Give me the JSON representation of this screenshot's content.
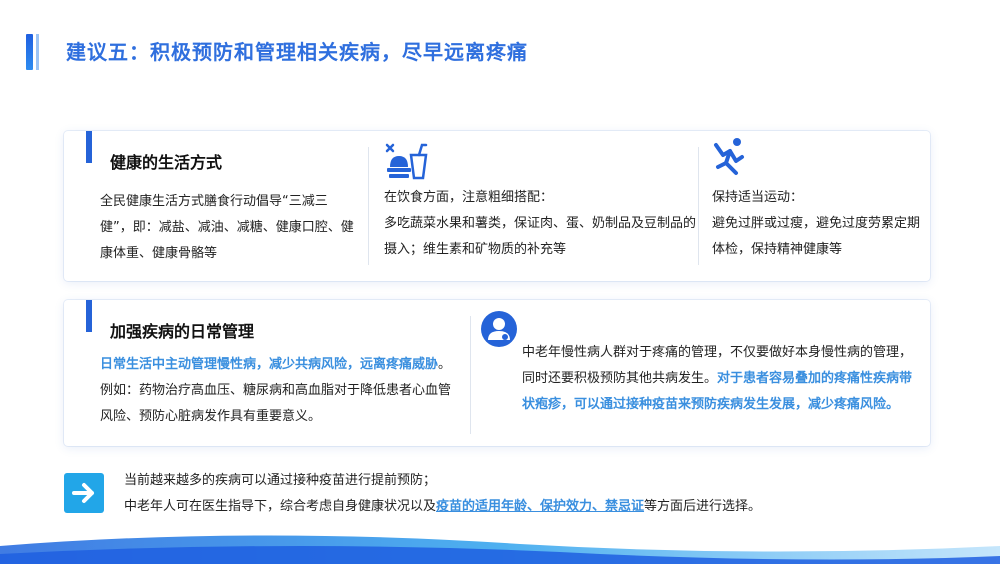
{
  "page": {
    "title": "建议五：积极预防和管理相关疾病，尽早远离疼痛"
  },
  "section1": {
    "title": "健康的生活方式",
    "col1_text": "全民健康生活方式膳食行动倡导“三减三健”，即：减盐、减油、减糖、健康口腔、健康体重、健康骨骼等",
    "col2_line1": "在饮食方面，注意粗细搭配：",
    "col2_line2": "多吃蔬菜水果和薯类，保证肉、蛋、奶制品及豆制品的摄入；维生素和矿物质的补充等",
    "col3_line1": "保持适当运动：",
    "col3_line2": "避免过胖或过瘦，避免过度劳累定期体检，保持精神健康等"
  },
  "section2": {
    "title": "加强疾病的日常管理",
    "left_highlight": "日常生活中主动管理慢性病，减少共病风险，远离疼痛威胁",
    "left_text": "。例如：药物治疗高血压、糖尿病和高血脂对于降低患者心血管风险、预防心脏病发作具有重要意义。",
    "right_text": "中老年慢性病人群对于疼痛的管理，不仅要做好本身慢性病的管理，同时还要积极预防其他共病发生。",
    "right_highlight": "对于患者容易叠加的疼痛性疾病带状疱疹，可以通过接种疫苗来预防疾病发生发展，减少疼痛风险。"
  },
  "footer": {
    "line1": "当前越来越多的疾病可以通过接种疫苗进行提前预防；",
    "line2_prefix": "中老年人可在医生指导下，综合考虑自身健康状况以及",
    "line2_highlight": "疫苗的适用年龄、保护效力、禁忌证",
    "line2_suffix": "等方面后进行选择。"
  },
  "icons": {
    "food": "food-drink-icon",
    "exercise": "running-person-icon",
    "doctor": "doctor-avatar-icon",
    "arrow": "arrow-right-icon"
  },
  "colors": {
    "accent": "#2f6fde",
    "highlight": "#3a8fdf",
    "arrow_bg": "#22a6e8"
  }
}
